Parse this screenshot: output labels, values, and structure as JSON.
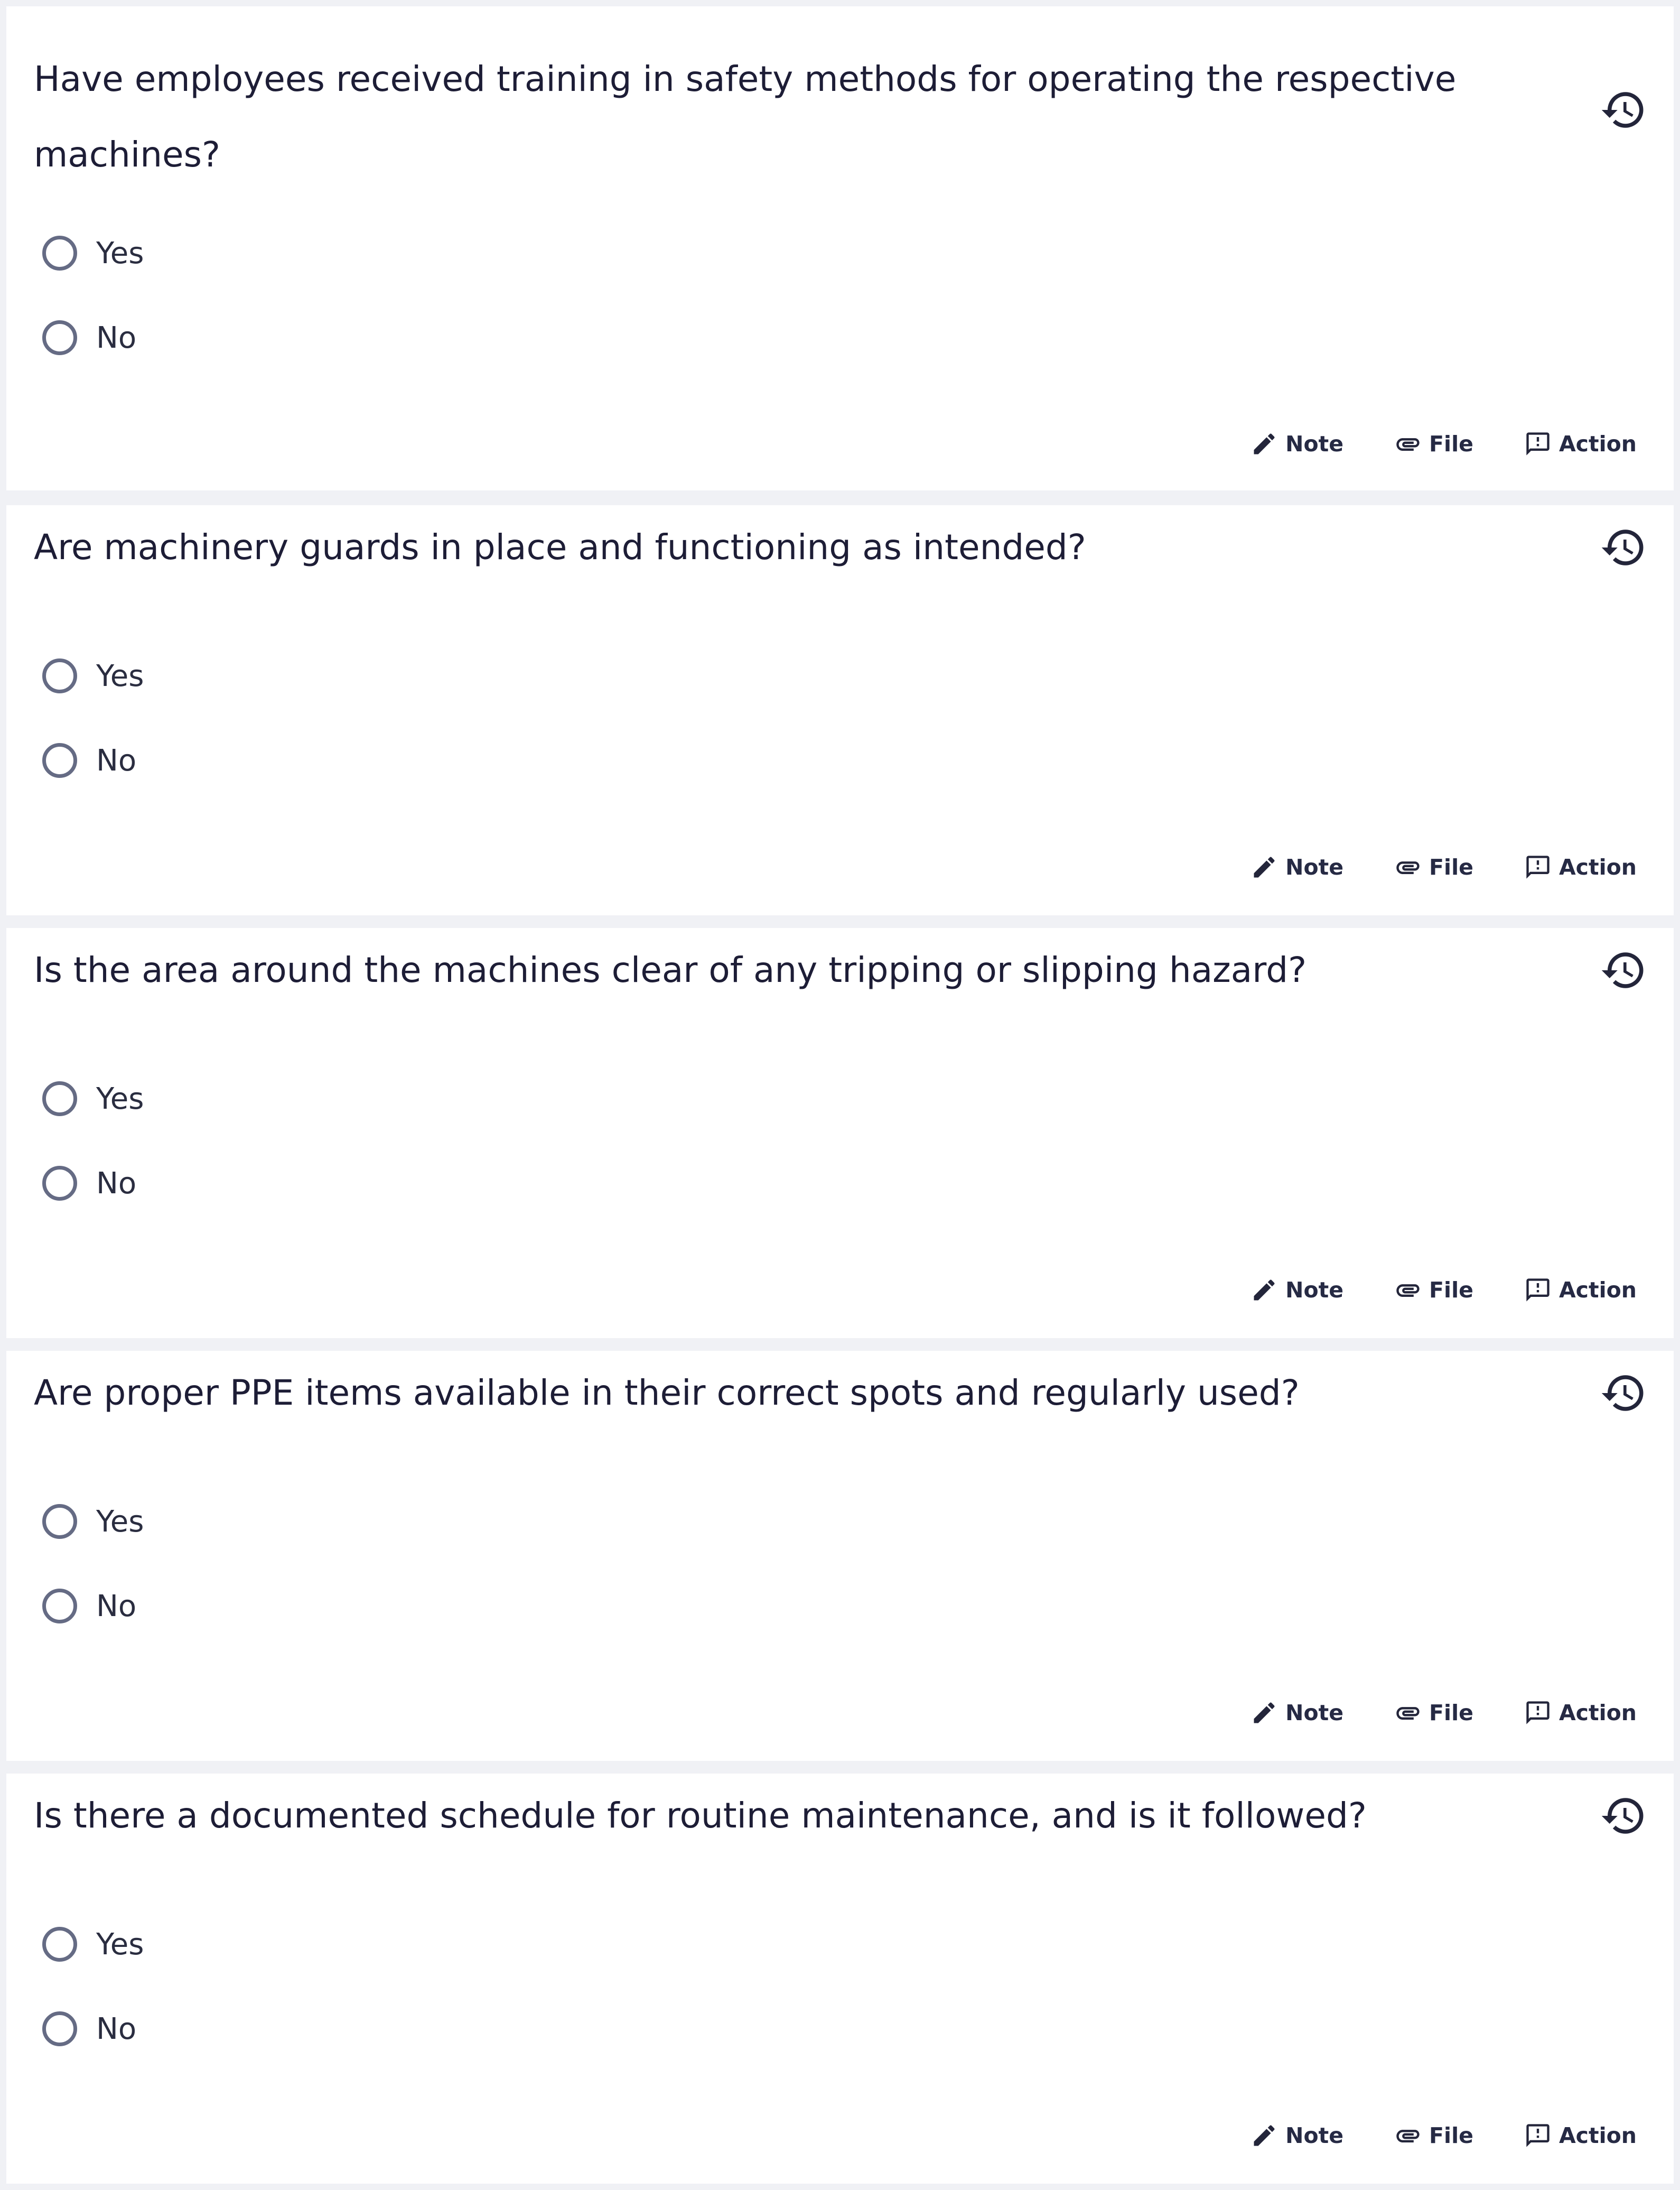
{
  "icons": {
    "history": "history-icon",
    "note": "pencil-icon",
    "file": "paperclip-icon",
    "action": "feedback-icon"
  },
  "colors": {
    "background": "#f0f1f5",
    "card": "#ffffff",
    "text": "#1d1d36",
    "radio_border": "#656b84"
  },
  "questions": [
    {
      "text": "Have employees received training in safety methods for operating the respective machines?",
      "options": [
        "Yes",
        "No"
      ],
      "actions": {
        "note": "Note",
        "file": "File",
        "action": "Action"
      }
    },
    {
      "text": "Are machinery guards in place and functioning as intended?",
      "options": [
        "Yes",
        "No"
      ],
      "actions": {
        "note": "Note",
        "file": "File",
        "action": "Action"
      }
    },
    {
      "text": "Is the area around the machines clear of any tripping or slipping hazard?",
      "options": [
        "Yes",
        "No"
      ],
      "actions": {
        "note": "Note",
        "file": "File",
        "action": "Action"
      }
    },
    {
      "text": "Are proper PPE items available in their correct spots and regularly used?",
      "options": [
        "Yes",
        "No"
      ],
      "actions": {
        "note": "Note",
        "file": "File",
        "action": "Action"
      }
    },
    {
      "text": "Is there a documented schedule for routine maintenance, and is it followed?",
      "options": [
        "Yes",
        "No"
      ],
      "actions": {
        "note": "Note",
        "file": "File",
        "action": "Action"
      }
    }
  ]
}
